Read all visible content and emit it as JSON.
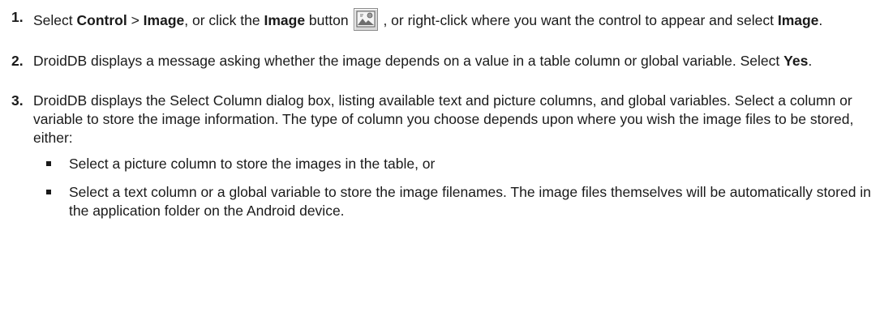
{
  "steps": [
    {
      "number": "1.",
      "parts": {
        "t1": "Select ",
        "b1": "Control",
        "t2": " > ",
        "b2": "Image",
        "t3": ", or click the ",
        "b3": "Image",
        "t4": " button",
        "t5": " , or right-click where you want the control to appear and select ",
        "b4": "Image",
        "t6": "."
      },
      "icon": "image-button-icon"
    },
    {
      "number": "2.",
      "parts": {
        "t1": "DroidDB displays a message asking whether the image depends on a value in a table column or global variable. Select ",
        "b1": "Yes",
        "t2": "."
      }
    },
    {
      "number": "3.",
      "parts": {
        "t1": "DroidDB displays the Select Column dialog box, listing available text and picture columns, and global variables. Select a column or variable to store the image information. The type of column you choose depends upon where you wish the image files to be stored, either:"
      }
    }
  ],
  "bullets": [
    "Select a picture column to store the images in the table, or",
    "Select a text column or a global variable to store the image filenames. The image files themselves will be automatically stored in the application folder on the Android device."
  ]
}
